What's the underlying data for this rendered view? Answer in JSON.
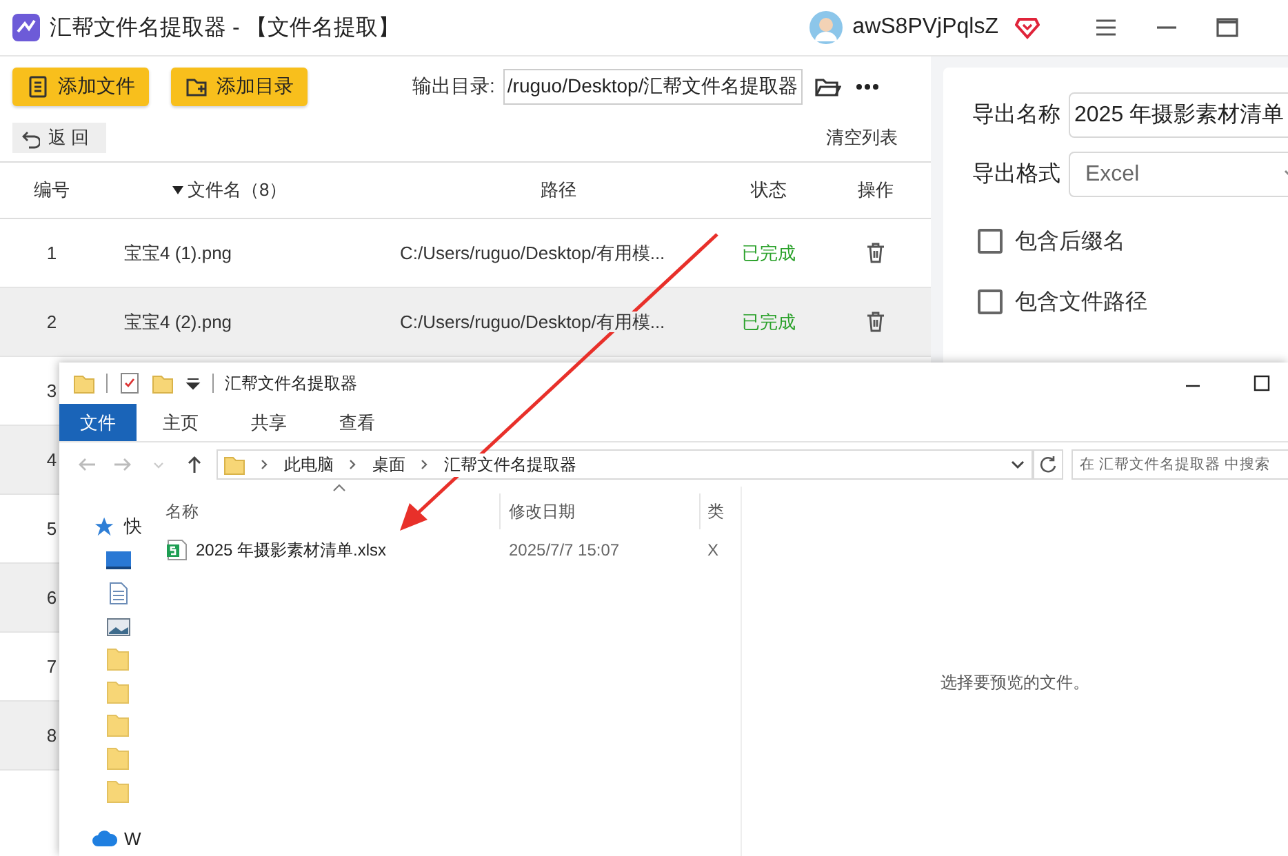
{
  "app": {
    "title": "汇帮文件名提取器 - 【文件名提取】",
    "user": {
      "name": "awS8PVjPqlsZ"
    },
    "toolbar": {
      "buttons": [
        {
          "kind": "file",
          "label": "添加文件"
        },
        {
          "kind": "folder",
          "label": "添加目录"
        }
      ],
      "output_label": "输出目录:",
      "output_value": "/ruguo/Desktop/汇帮文件名提取器",
      "back": "返 回",
      "clear": "清空列表"
    },
    "table": {
      "columns": [
        "编号",
        "文件名（8）",
        "路径",
        "状态",
        "操作"
      ],
      "rows": [
        {
          "number": "1",
          "name": "宝宝4 (1).png",
          "path": "C:/Users/ruguo/Desktop/有用模...",
          "status": "已完成"
        },
        {
          "number": "2",
          "name": "宝宝4 (2).png",
          "path": "C:/Users/ruguo/Desktop/有用模...",
          "status": "已完成"
        },
        {
          "number": "3"
        },
        {
          "number": "4"
        },
        {
          "number": "5"
        },
        {
          "number": "6"
        },
        {
          "number": "7"
        },
        {
          "number": "8"
        }
      ]
    },
    "export": {
      "name_label": "导出名称",
      "name_value": "2025 年摄影素材清单",
      "format_label": "导出格式",
      "format_value": "Excel",
      "options": [
        {
          "label": "包含后缀名",
          "checked": false
        },
        {
          "label": "包含文件路径",
          "checked": false
        }
      ]
    }
  },
  "explorer": {
    "title": "汇帮文件名提取器",
    "ribbon_tabs": [
      {
        "label": "文件",
        "selected": true
      },
      {
        "label": "主页",
        "selected": false
      },
      {
        "label": "共享",
        "selected": false
      },
      {
        "label": "查看",
        "selected": false
      }
    ],
    "breadcrumbs": [
      "此电脑",
      "桌面",
      "汇帮文件名提取器"
    ],
    "search": {
      "placeholder": "在 汇帮文件名提取器 中搜索"
    },
    "nav_items": [
      {
        "kind": "star",
        "label": "快"
      },
      {
        "kind": "desktop"
      },
      {
        "kind": "document"
      },
      {
        "kind": "picture"
      },
      {
        "kind": "folder"
      },
      {
        "kind": "folder"
      },
      {
        "kind": "folder"
      },
      {
        "kind": "folder"
      },
      {
        "kind": "folder"
      },
      {
        "kind": "cloud",
        "label": "W"
      }
    ],
    "columns": [
      "名称",
      "修改日期",
      "类"
    ],
    "files": [
      {
        "name": "2025 年摄影素材清单.xlsx",
        "modified": "2025/7/7 15:07",
        "type": "X"
      }
    ],
    "preview_message": "选择要预览的文件。"
  }
}
